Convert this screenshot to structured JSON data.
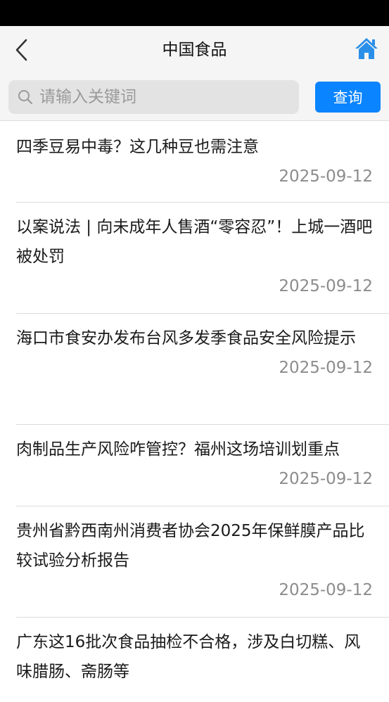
{
  "header": {
    "title": "中国食品"
  },
  "search": {
    "placeholder": "请输入关键词",
    "value": "",
    "button_label": "查询"
  },
  "colors": {
    "accent": "#0a84ff",
    "nav_background": "#f5f5f5",
    "status_bar": "#000000"
  },
  "icons": {
    "back": "chevron-left-icon",
    "home": "home-icon",
    "search": "search-icon"
  },
  "news": [
    {
      "title": "四季豆易中毒？这几种豆也需注意",
      "date": "2025-09-12"
    },
    {
      "title": "以案说法 | 向未成年人售酒“零容忍”！上城一酒吧被处罚",
      "date": "2025-09-12"
    },
    {
      "title": "海口市食安办发布台风多发季食品安全风险提示",
      "date": "2025-09-12"
    },
    {
      "title": "肉制品生产风险咋管控？福州这场培训划重点",
      "date": "2025-09-12"
    },
    {
      "title": "贵州省黔西南州消费者协会2025年保鲜膜产品比较试验分析报告",
      "date": "2025-09-12"
    },
    {
      "title": "广东这16批次食品抽检不合格，涉及白切糕、风味腊肠、斋肠等",
      "date": ""
    }
  ]
}
